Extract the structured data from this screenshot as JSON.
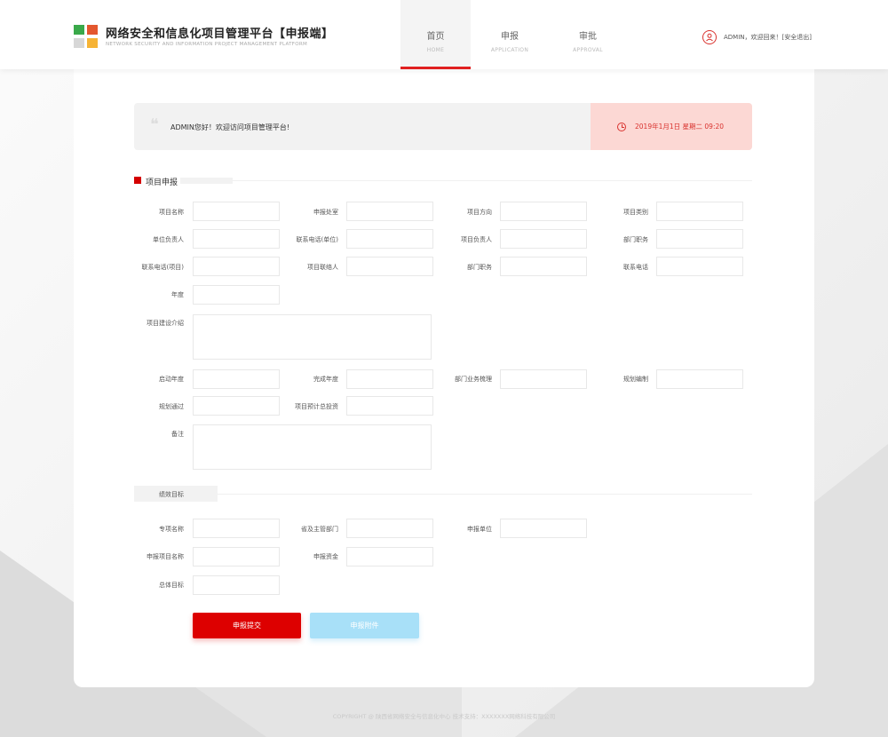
{
  "header": {
    "title": "网络安全和信息化项目管理平台【申报端】",
    "subtitle": "NETWORK SECURITY AND INFORMATION PROJECT MANAGEMENT PLATFORM",
    "nav": [
      {
        "zh": "首页",
        "en": "HOME",
        "active": true
      },
      {
        "zh": "申报",
        "en": "APPLICATION",
        "active": false
      },
      {
        "zh": "审批",
        "en": "APPROVAL",
        "active": false
      }
    ],
    "user_text": "ADMIN，欢迎回来！[安全退出]",
    "user_icon": "user-icon"
  },
  "welcome": {
    "message": "ADMIN您好！欢迎访问项目管理平台!",
    "quote_icon": "quote-icon",
    "date": "2019年1月1日 星期二 09:20",
    "clock_icon": "clock-icon"
  },
  "section": {
    "title": "项目申报",
    "labels": {
      "project_name": "项目名称",
      "dept": "申报处室",
      "direction": "项目方向",
      "category": "项目类别",
      "unit_leader": "单位负责人",
      "unit_phone": "联系电话(单位)",
      "project_leader": "项目负责人",
      "dept_position": "部门职务",
      "project_phone": "联系电话(项目)",
      "project_contact": "项目联络人",
      "dept_position2": "部门职务",
      "phone": "联系电话",
      "year": "年度",
      "intro": "项目建设介绍",
      "start_year": "启动年度",
      "finish_year": "完成年度",
      "dept_business": "部门业务梳理",
      "plan_compile": "规划编制",
      "plan_pass": "规划通过",
      "total_invest": "项目预计总投资",
      "remark": "备注"
    }
  },
  "performance": {
    "title": "绩效目标",
    "labels": {
      "special_name": "专项名称",
      "province_dept": "省及主管部门",
      "apply_unit": "申报单位",
      "apply_project_name": "申报项目名称",
      "apply_fund": "申报资金",
      "overall_goal": "总体目标"
    }
  },
  "buttons": {
    "submit": "申报提交",
    "attach": "申报附件"
  },
  "footer": "COPYRIGHT @ 陕西省网络安全与信息化中心  技术支持：XXXXXXX网络科技有限公司",
  "colors": {
    "accent": "#dd0000",
    "date_bg": "#fcd8d4",
    "attach_btn": "#a8e0f8"
  }
}
